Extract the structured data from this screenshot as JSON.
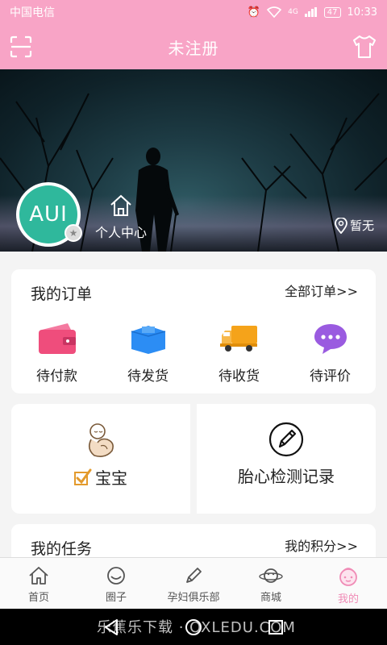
{
  "status_bar": {
    "carrier": "中国电信",
    "time": "10:33",
    "network": "4G",
    "battery": "47"
  },
  "header": {
    "title": "未注册"
  },
  "profile": {
    "avatar_text": "AUI",
    "center_label": "个人中心",
    "location": "暂无"
  },
  "orders": {
    "title": "我的订单",
    "all_link": "全部订单>>",
    "items": [
      {
        "label": "待付款",
        "icon": "wallet-icon",
        "color": "#ef4d7c"
      },
      {
        "label": "待发货",
        "icon": "package-icon",
        "color": "#2c8df4"
      },
      {
        "label": "待收货",
        "icon": "truck-icon",
        "color": "#f5a31a"
      },
      {
        "label": "待评价",
        "icon": "chat-bubble-icon",
        "color": "#9a5be0"
      }
    ]
  },
  "features": {
    "baby_label": "宝宝",
    "heartbeat_label": "胎心检测记录"
  },
  "tasks": {
    "title": "我的任务",
    "points_link": "我的积分>>"
  },
  "tabs": [
    {
      "label": "首页",
      "icon": "home-icon"
    },
    {
      "label": "圈子",
      "icon": "circle-chat-icon"
    },
    {
      "label": "孕妇俱乐部",
      "icon": "pencil-icon"
    },
    {
      "label": "商城",
      "icon": "planet-icon"
    },
    {
      "label": "我的",
      "icon": "baby-face-icon"
    }
  ],
  "watermark": "乐蕉乐下载 · OXLEDU.COM",
  "colors": {
    "accent": "#f8a4c6",
    "active_tab": "#f08bb6",
    "avatar_bg": "#2fb89c"
  }
}
